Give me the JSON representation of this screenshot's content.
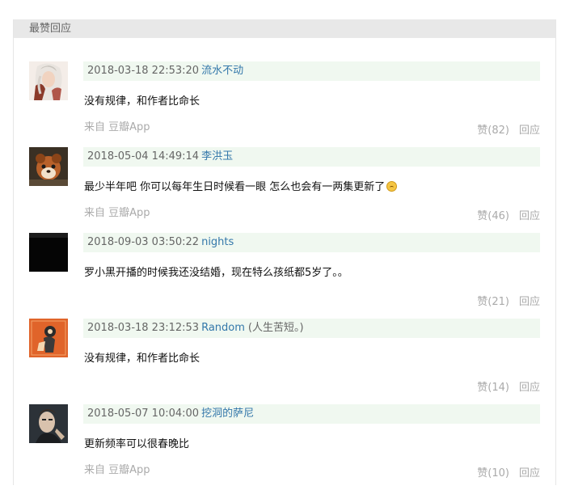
{
  "header": {
    "title": "最赞回应"
  },
  "comments": [
    {
      "time": "2018-03-18 22:53:20",
      "user": "流水不动",
      "note": "",
      "content": "没有规律，和作者比命长",
      "source_prefix": "来自",
      "source_app": "豆瓣App",
      "likes": "赞(82)",
      "reply": "回应"
    },
    {
      "time": "2018-05-04 14:49:14",
      "user": "李洪玉",
      "note": "",
      "content": "最少半年吧 你可以每年生日时候看一眼 怎么也会有一两集更新了",
      "source_prefix": "来自",
      "source_app": "豆瓣App",
      "likes": "赞(46)",
      "reply": "回应"
    },
    {
      "time": "2018-09-03 03:50:22",
      "user": "nights",
      "note": "",
      "content": "罗小黑开播的时候我还没结婚，现在特么孩纸都5岁了。。",
      "source_prefix": "",
      "source_app": "",
      "likes": "赞(21)",
      "reply": "回应"
    },
    {
      "time": "2018-03-18 23:12:53",
      "user": "Random",
      "note": "(人生苦短。)",
      "content": "没有规律，和作者比命长",
      "source_prefix": "",
      "source_app": "",
      "likes": "赞(14)",
      "reply": "回应"
    },
    {
      "time": "2018-05-07 10:04:00",
      "user": "挖洞的萨尼",
      "note": "",
      "content": "更新频率可以很春晚比",
      "source_prefix": "来自",
      "source_app": "豆瓣App",
      "likes": "赞(10)",
      "reply": "回应"
    }
  ],
  "colors": {
    "header_bg": "#e8e8e8",
    "meta_bg": "#f0f8f0",
    "link": "#3377aa",
    "muted": "#aaaaaa"
  }
}
